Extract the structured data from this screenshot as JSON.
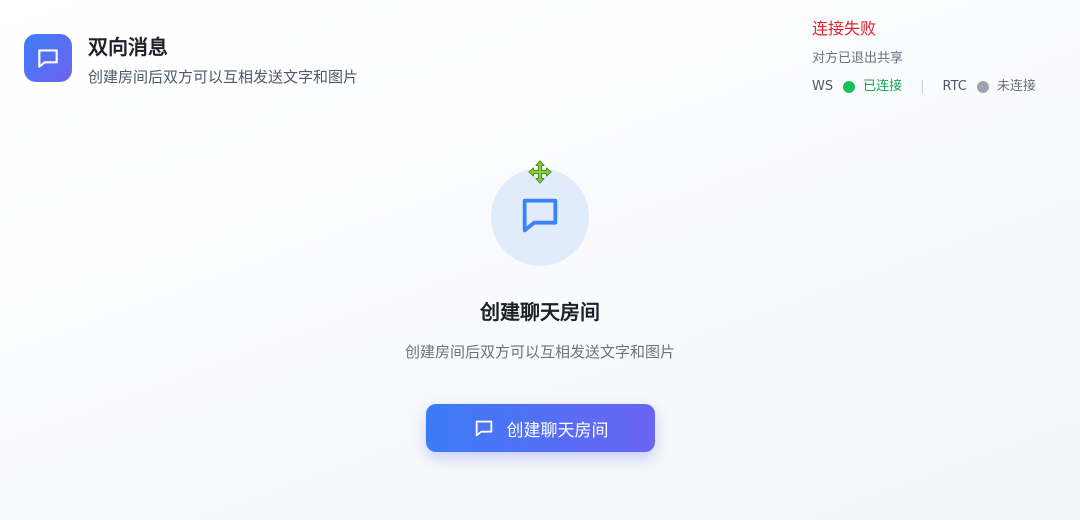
{
  "header": {
    "icon": "message-square-icon",
    "title": "双向消息",
    "subtitle": "创建房间后双方可以互相发送文字和图片"
  },
  "status": {
    "error_text": "连接失败",
    "peer_text": "对方已退出共享",
    "ws": {
      "label": "WS",
      "state": "已连接",
      "color": "#14c15a"
    },
    "separator": "|",
    "rtc": {
      "label": "RTC",
      "state": "未连接",
      "color": "#9ea3ad"
    }
  },
  "main": {
    "hero_icon": "message-square-icon",
    "overlay_icon": "move-cursor-icon",
    "title": "创建聊天房间",
    "description": "创建房间后双方可以互相发送文字和图片",
    "button_label": "创建聊天房间",
    "button_icon": "message-square-icon"
  },
  "colors": {
    "accent_start": "#3b7cf6",
    "accent_end": "#6a64f2",
    "error": "#e0242f",
    "success": "#14c15a"
  }
}
